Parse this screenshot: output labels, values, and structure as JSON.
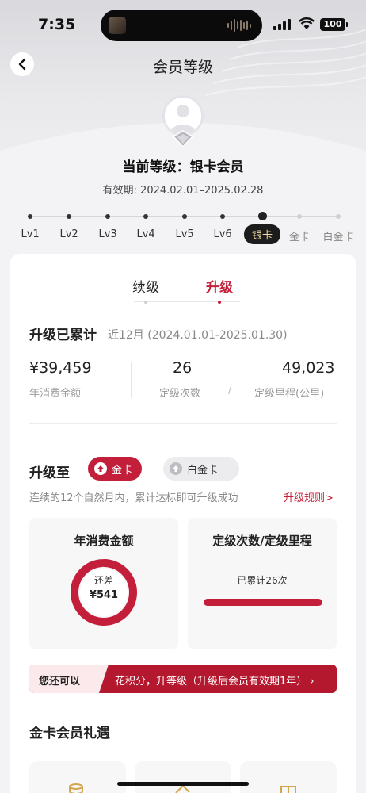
{
  "status_bar": {
    "time": "7:35",
    "battery": "100"
  },
  "nav": {
    "title": "会员等级"
  },
  "member": {
    "current_level": "当前等级：银卡会员",
    "validity": "有效期: 2024.02.01–2025.02.28"
  },
  "levels": [
    "Lv1",
    "Lv2",
    "Lv3",
    "Lv4",
    "Lv5",
    "Lv6",
    "银卡",
    "金卡",
    "白金卡"
  ],
  "current_level_index": 6,
  "tabs": {
    "renew": "续级",
    "upgrade": "升级",
    "active": "升级"
  },
  "accumulated": {
    "title": "升级已累计",
    "period": "近12月 (2024.01.01-2025.01.30)",
    "spend_value": "¥39,459",
    "spend_label": "年消费金额",
    "count_value": "26",
    "count_label": "定级次数",
    "slash": "/",
    "mileage_value": "49,023",
    "mileage_label": "定级里程(公里)"
  },
  "upgrade_to": {
    "label": "升级至",
    "option_gold": "金卡",
    "option_platinum": "白金卡",
    "selected": "金卡",
    "note": "连续的12个自然月内，累计达标即可升级成功",
    "rules_link": "升级规则>"
  },
  "progress": {
    "spend_title": "年消费金额",
    "spend_remaining_label": "还差",
    "spend_remaining_value": "¥541",
    "spend_ring_fraction": 0.985,
    "count_title": "定级次数/定级里程",
    "count_accumulated": "已累计26次",
    "count_bar_fraction": 1.0
  },
  "banner": {
    "left_text": "您还可以",
    "right_text": "花积分，升等级（升级后会员有效期1年） ›"
  },
  "benefits": {
    "title": "金卡会员礼遇"
  },
  "colors": {
    "accent": "#c31f3b",
    "silver_badge_bg": "#1c1c1c",
    "silver_badge_text": "#f1d9a6"
  }
}
